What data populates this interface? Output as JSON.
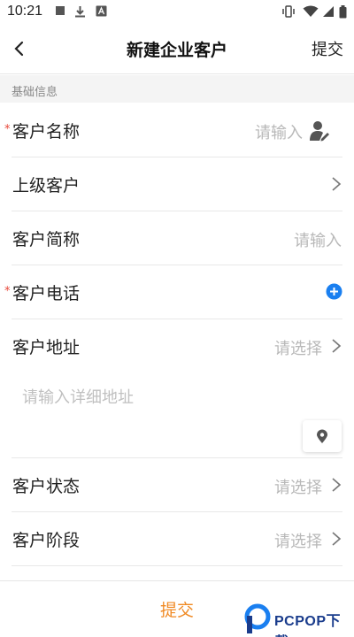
{
  "status_bar": {
    "time": "10:21",
    "left_icons": [
      "stop-square-icon",
      "download-icon",
      "text-a-icon"
    ],
    "right_icons": [
      "vibrate-icon",
      "wifi-icon",
      "signal-icon",
      "battery-icon"
    ]
  },
  "nav": {
    "title": "新建企业客户",
    "submit_label": "提交",
    "back_icon": "chevron-left-icon"
  },
  "section": {
    "title": "基础信息"
  },
  "fields": {
    "name": {
      "label": "客户名称",
      "placeholder": "请输入",
      "required": true,
      "icon": "contact-pick-icon"
    },
    "parent": {
      "label": "上级客户"
    },
    "short_name": {
      "label": "客户简称",
      "placeholder": "请输入"
    },
    "phone": {
      "label": "客户电话",
      "required": true,
      "icon": "add-circle-icon"
    },
    "address": {
      "label": "客户地址",
      "placeholder": "请选择"
    },
    "address_detail": {
      "placeholder": "请输入详细地址",
      "icon": "location-pin-icon"
    },
    "status": {
      "label": "客户状态",
      "placeholder": "请选择"
    },
    "stage": {
      "label": "客户阶段",
      "placeholder": "请选择"
    }
  },
  "required_mark": "*",
  "bottom": {
    "submit_label": "提交"
  },
  "watermark": {
    "text": "PCPOP下载"
  },
  "colors": {
    "accent_orange": "#f08a24",
    "add_blue": "#1a7ff0",
    "required_red": "#e8483a",
    "placeholder_gray": "#b8b8b8"
  }
}
